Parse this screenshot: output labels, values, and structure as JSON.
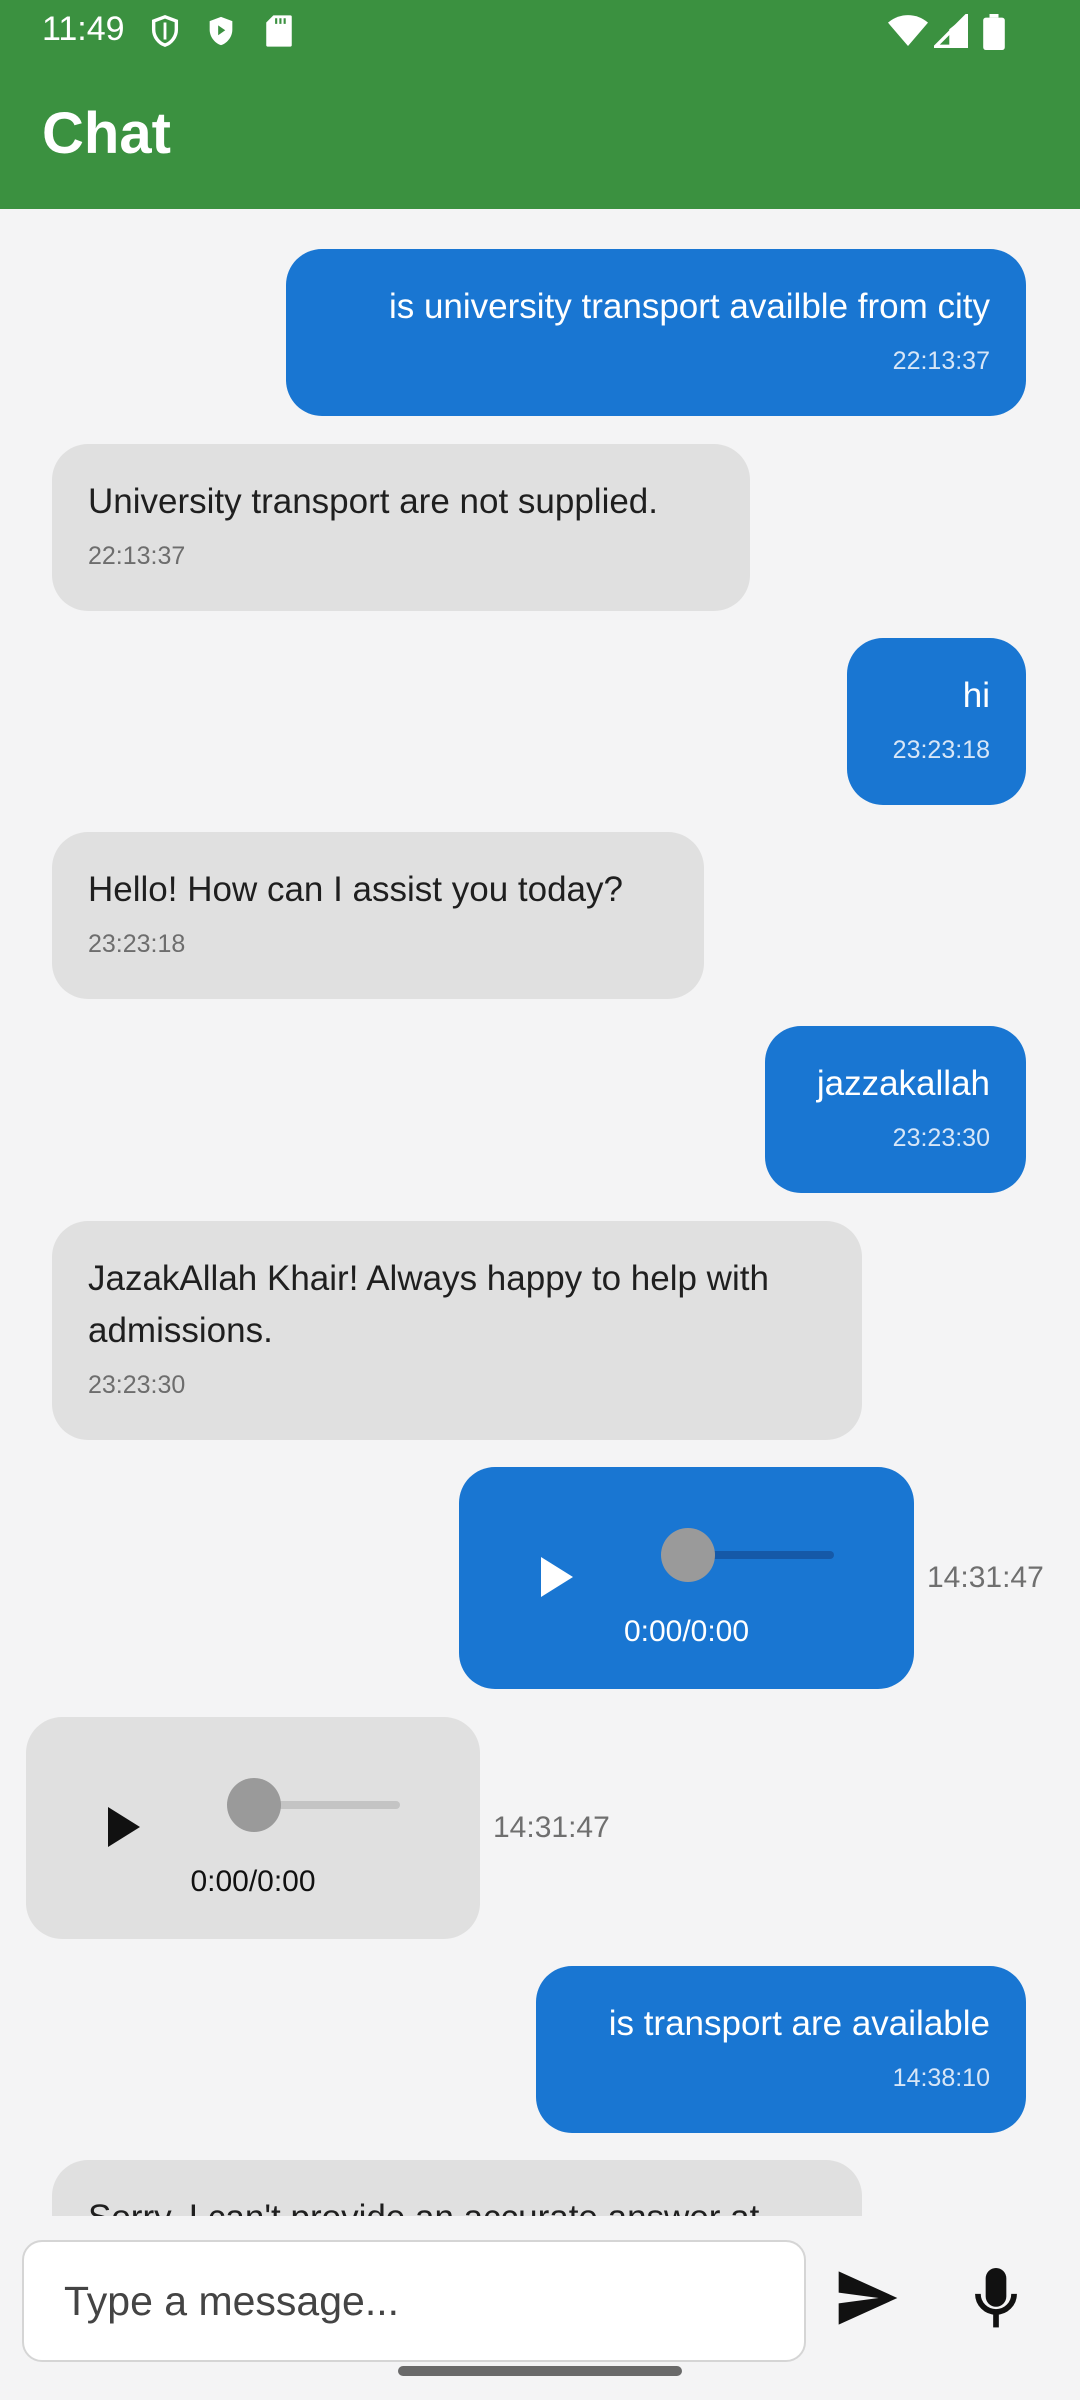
{
  "status_bar": {
    "time": "11:49",
    "icons": [
      "shield-icon",
      "play-protect-icon",
      "sd-card-icon",
      "wifi-icon",
      "signal-icon",
      "battery-icon"
    ]
  },
  "app_bar": {
    "title": "Chat"
  },
  "messages": [
    {
      "sender": "user",
      "text": "is university transport availble from city",
      "time": "22:13:37"
    },
    {
      "sender": "bot",
      "text": "University transport are not supplied.",
      "time": "22:13:37"
    },
    {
      "sender": "user",
      "text": "hi",
      "time": "23:23:18"
    },
    {
      "sender": "bot",
      "text": "Hello! How can I assist you today?",
      "time": "23:23:18"
    },
    {
      "sender": "user",
      "text": "jazzakallah",
      "time": "23:23:30"
    },
    {
      "sender": "bot",
      "text": "JazakAllah Khair! Always happy to help with admissions.",
      "time": "23:23:30"
    },
    {
      "sender": "user",
      "type": "audio",
      "duration": "0:00/0:00",
      "time": "14:31:47",
      "progress": 0
    },
    {
      "sender": "bot",
      "type": "audio",
      "duration": "0:00/0:00",
      "time": "14:31:47",
      "progress": 0
    },
    {
      "sender": "user",
      "text": "is transport are available",
      "time": "14:38:10"
    },
    {
      "sender": "bot",
      "text": "Sorry, I can't provide an accurate answer at",
      "time": ""
    }
  ],
  "composer": {
    "placeholder": "Type a message...",
    "send_icon": "send-icon",
    "mic_icon": "mic-icon"
  },
  "colors": {
    "app_bar": "#3b9140",
    "user_bubble": "#1976d2",
    "bot_bubble": "#e0e0e0",
    "background": "#f4f4f5"
  }
}
